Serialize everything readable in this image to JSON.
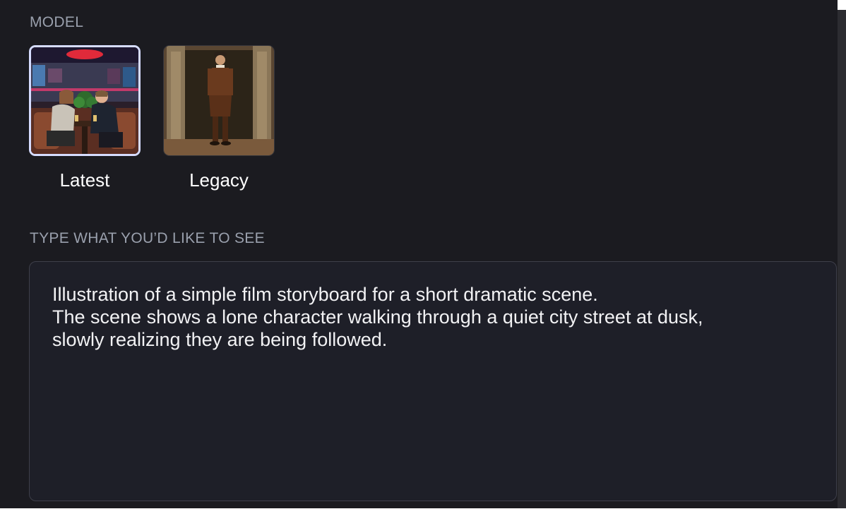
{
  "model_section": {
    "label": "MODEL",
    "options": [
      {
        "name": "Latest",
        "selected": true,
        "thumbnail": "diner-couple-photo"
      },
      {
        "name": "Legacy",
        "selected": false,
        "thumbnail": "renaissance-portrait-painting"
      }
    ]
  },
  "prompt_section": {
    "label": "TYPE WHAT YOU’D LIKE TO SEE",
    "lines": [
      "Illustration of a simple film storyboard for a short dramatic scene.",
      "The scene shows a lone character walking through a quiet city street at dusk,",
      "slowly realizing they are being followed."
    ]
  },
  "colors": {
    "panel_bg": "#1b1b20",
    "prompt_bg": "#1e1f28",
    "selected_border": "#d6dcff",
    "label_text": "#9aa0ad"
  }
}
